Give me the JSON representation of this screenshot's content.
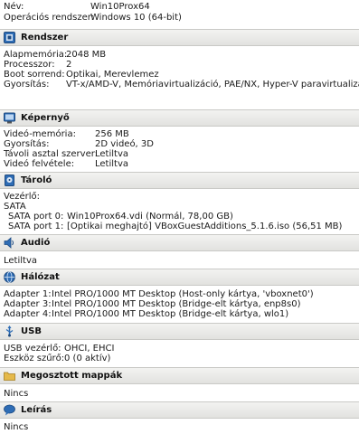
{
  "general": {
    "rows": [
      {
        "label": "Név:",
        "value": "Win10Prox64"
      },
      {
        "label": "Operációs rendszer:",
        "value": "Windows 10 (64-bit)"
      }
    ]
  },
  "system": {
    "title": "Rendszer",
    "icon": "chip-icon",
    "rows": [
      {
        "label": "Alapmemória:",
        "value": "2048 MB"
      },
      {
        "label": "Processzor:",
        "value": "2"
      },
      {
        "label": "Boot sorrend:",
        "value": "Optikai, Merevlemez"
      },
      {
        "label": "Gyorsítás:",
        "value": "VT-x/AMD-V, Memóriavirtualizáció, PAE/NX, Hyper-V paravirtualizáció"
      }
    ]
  },
  "display": {
    "title": "Képernyő",
    "icon": "monitor-icon",
    "rows": [
      {
        "label": "Videó-memória:",
        "value": "256 MB"
      },
      {
        "label": "Gyorsítás:",
        "value": "2D videó, 3D"
      },
      {
        "label": "Távoli asztal szerver:",
        "value": "Letiltva"
      },
      {
        "label": "Videó felvétele:",
        "value": "Letiltva"
      }
    ]
  },
  "storage": {
    "title": "Tároló",
    "icon": "storage-icon",
    "controller_label": "Vezérlő:",
    "controller_name": "SATA",
    "rows": [
      {
        "label": "SATA port 0:",
        "value": "Win10Prox64.vdi (Normál, 78,00 GB)"
      },
      {
        "label": "SATA port 1:",
        "value": "[Optikai meghajtó] VBoxGuestAdditions_5.1.6.iso (56,51 MB)"
      }
    ]
  },
  "audio": {
    "title": "Audió",
    "icon": "speaker-icon",
    "status": "Letiltva"
  },
  "network": {
    "title": "Hálózat",
    "icon": "network-icon",
    "rows": [
      {
        "label": "Adapter 1:",
        "value": "Intel PRO/1000 MT Desktop (Host-only kártya, 'vboxnet0')"
      },
      {
        "label": "Adapter 3:",
        "value": "Intel PRO/1000 MT Desktop (Bridge-elt kártya, enp8s0)"
      },
      {
        "label": "Adapter 4:",
        "value": "Intel PRO/1000 MT Desktop (Bridge-elt kártya, wlo1)"
      }
    ]
  },
  "usb": {
    "title": "USB",
    "icon": "usb-icon",
    "rows": [
      {
        "label": "USB vezérlő:",
        "value": "OHCI, EHCI"
      },
      {
        "label": "Eszköz szűrő:",
        "value": "0 (0 aktív)"
      }
    ]
  },
  "shared": {
    "title": "Megosztott mappák",
    "icon": "folder-icon",
    "status": "Nincs"
  },
  "description": {
    "title": "Leírás",
    "icon": "speech-bubble-icon",
    "status": "Nincs"
  }
}
